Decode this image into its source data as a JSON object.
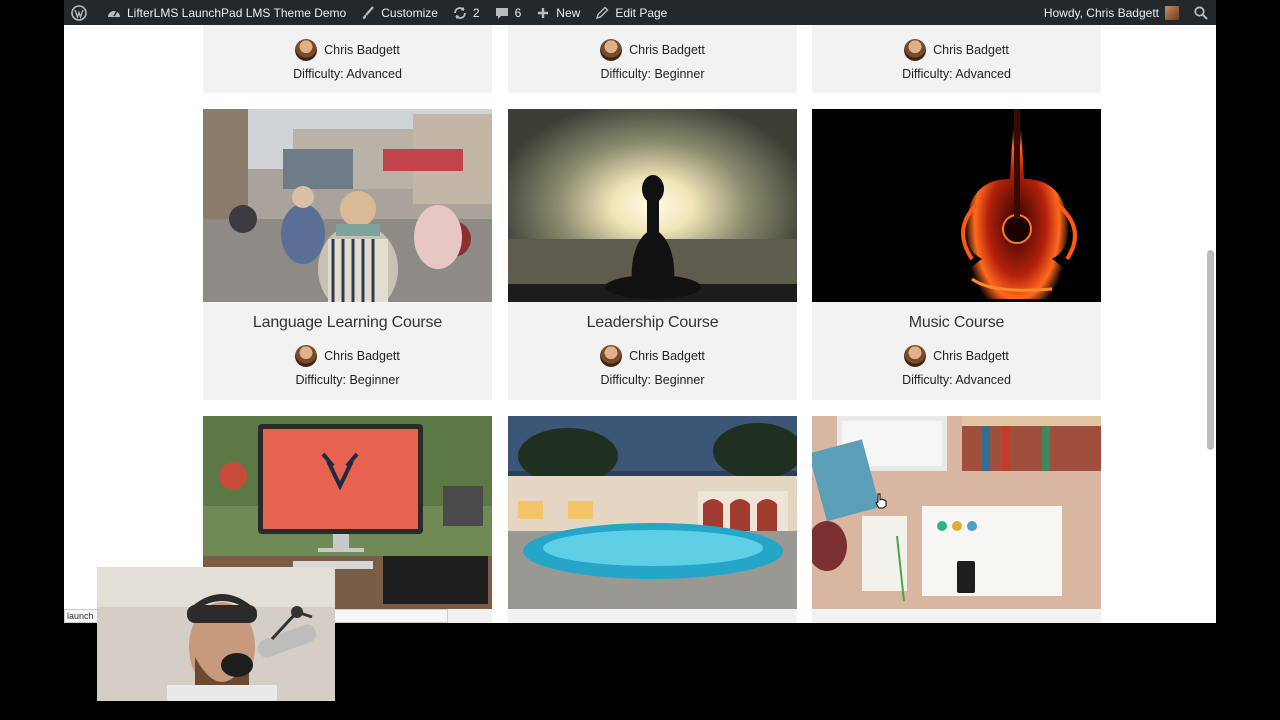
{
  "adminbar": {
    "site_title": "LifterLMS LaunchPad LMS Theme Demo",
    "customize": "Customize",
    "updates_count": "2",
    "comments_count": "6",
    "new_label": "New",
    "edit_page": "Edit Page",
    "howdy": "Howdy, Chris Badgett"
  },
  "top_row": [
    {
      "author": "Chris Badgett",
      "difficulty": "Difficulty: Advanced"
    },
    {
      "author": "Chris Badgett",
      "difficulty": "Difficulty: Beginner"
    },
    {
      "author": "Chris Badgett",
      "difficulty": "Difficulty: Advanced"
    }
  ],
  "courses": [
    {
      "title": "Language Learning Course",
      "author": "Chris Badgett",
      "difficulty": "Difficulty: Beginner"
    },
    {
      "title": "Leadership Course",
      "author": "Chris Badgett",
      "difficulty": "Difficulty: Beginner"
    },
    {
      "title": "Music Course",
      "author": "Chris Badgett",
      "difficulty": "Difficulty: Advanced"
    }
  ],
  "status_url": "launch"
}
